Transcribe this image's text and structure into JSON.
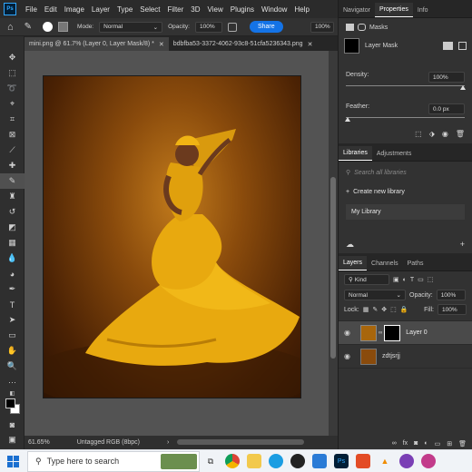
{
  "menu": {
    "items": [
      "File",
      "Edit",
      "Image",
      "Layer",
      "Type",
      "Select",
      "Filter",
      "3D",
      "View",
      "Plugins",
      "Window",
      "Help"
    ]
  },
  "options": {
    "mode_label": "Mode:",
    "mode_value": "Normal",
    "opacity_label": "Opacity:",
    "opacity_value": "100%",
    "flow_value": "100%",
    "share_label": "Share"
  },
  "tabs": [
    {
      "label": "mini.png @ 61.7% (Layer 0, Layer Mask/8) *"
    },
    {
      "label": "bdbfba53-3372-4062-93c8-51cfa5236343.png"
    }
  ],
  "status": {
    "zoom": "61.65%",
    "profile": "Untagged RGB (8bpc)"
  },
  "properties": {
    "tabs": [
      "Navigator",
      "Properties",
      "Info"
    ],
    "masks_label": "Masks",
    "layer_mask_label": "Layer Mask",
    "density_label": "Density:",
    "density_value": "100%",
    "density_fraction": 1.0,
    "feather_label": "Feather:",
    "feather_value": "0.0 px",
    "feather_fraction": 0.0
  },
  "libraries": {
    "tabs": [
      "Libraries",
      "Adjustments"
    ],
    "search_placeholder": "Search all libraries",
    "create_label": "Create new library",
    "my_library": "My Library"
  },
  "layers": {
    "tabs": [
      "Layers",
      "Channels",
      "Paths"
    ],
    "kind_label": "Kind",
    "blend_mode": "Normal",
    "opacity_label": "Opacity:",
    "opacity_value": "100%",
    "lock_label": "Lock:",
    "fill_label": "Fill:",
    "fill_value": "100%",
    "items": [
      {
        "name": "Layer 0"
      },
      {
        "name": "zdtjsrjj"
      }
    ]
  },
  "taskbar": {
    "search_placeholder": "Type here to search"
  },
  "colors": {
    "accent": "#1473e6",
    "panel": "#323232",
    "dress": "#e8a90f",
    "background": "#8a4b0c"
  }
}
